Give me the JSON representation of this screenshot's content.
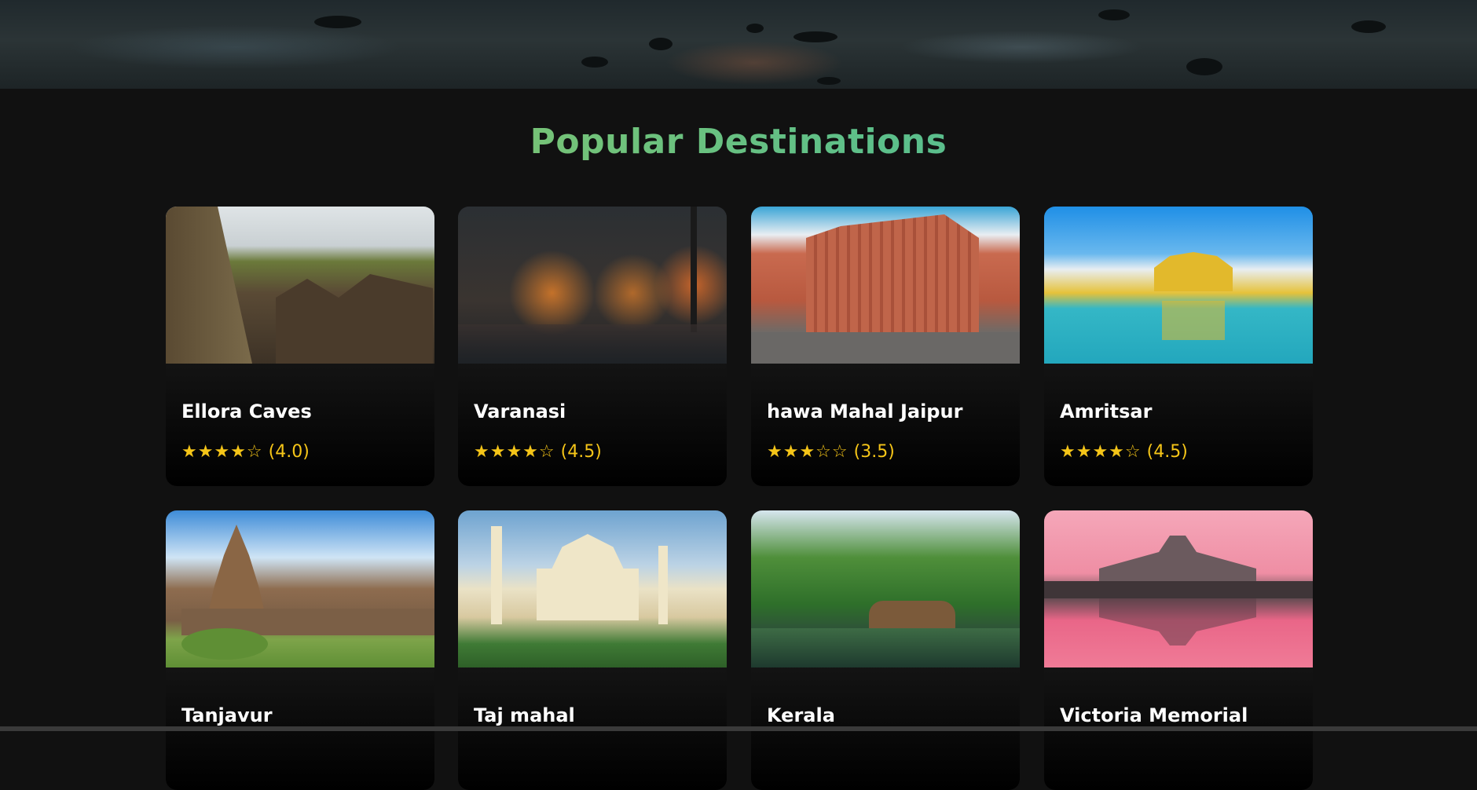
{
  "section": {
    "title": "Popular Destinations"
  },
  "destinations": [
    {
      "name": "Ellora Caves",
      "stars": "★★★★☆",
      "rating": "(4.0)",
      "photo": "ellora-caves-photo"
    },
    {
      "name": "Varanasi",
      "stars": "★★★★☆",
      "rating": "(4.5)",
      "photo": "varanasi-photo"
    },
    {
      "name": "hawa Mahal Jaipur",
      "stars": "★★★☆☆",
      "rating": "(3.5)",
      "photo": "hawa-mahal-photo"
    },
    {
      "name": "Amritsar",
      "stars": "★★★★☆",
      "rating": "(4.5)",
      "photo": "amritsar-photo"
    },
    {
      "name": "Tanjavur",
      "stars": "",
      "rating": "",
      "photo": "tanjavur-photo"
    },
    {
      "name": "Taj mahal",
      "stars": "",
      "rating": "",
      "photo": "taj-mahal-photo"
    },
    {
      "name": "Kerala",
      "stars": "",
      "rating": "",
      "photo": "kerala-photo"
    },
    {
      "name": "Victoria Memorial",
      "stars": "",
      "rating": "",
      "photo": "victoria-memorial-photo"
    }
  ],
  "colors": {
    "background": "#111111",
    "title_gradient_start": "#9cc85a",
    "title_gradient_end": "#4fb7a0",
    "star": "#f5c518",
    "card_text": "#ffffff"
  }
}
